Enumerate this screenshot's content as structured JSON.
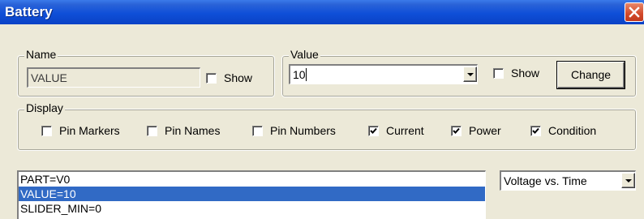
{
  "window": {
    "title": "Battery"
  },
  "name_group": {
    "legend": "Name",
    "value": "VALUE",
    "show_label": "Show",
    "show_checked": false
  },
  "value_group": {
    "legend": "Value",
    "value": "10",
    "show_label": "Show",
    "show_checked": false,
    "change_label": "Change"
  },
  "display_group": {
    "legend": "Display",
    "options": [
      {
        "label": "Pin Markers",
        "checked": false
      },
      {
        "label": "Pin Names",
        "checked": false
      },
      {
        "label": "Pin Numbers",
        "checked": false
      },
      {
        "label": "Current",
        "checked": true
      },
      {
        "label": "Power",
        "checked": true
      },
      {
        "label": "Condition",
        "checked": true
      }
    ]
  },
  "attributes": {
    "items": [
      "PART=V0",
      "VALUE=10",
      "SLIDER_MIN=0"
    ],
    "selected_index": 1
  },
  "plot_select": {
    "selected": "Voltage vs. Time"
  },
  "colors": {
    "title_bar": "#0A42C6",
    "selection": "#316AC5",
    "dialog_bg": "#ECE9D8",
    "close_button": "#D2492A"
  },
  "icons": {
    "close": "close-x-icon",
    "dropdown": "chevron-down-icon",
    "check": "checkmark-icon"
  }
}
